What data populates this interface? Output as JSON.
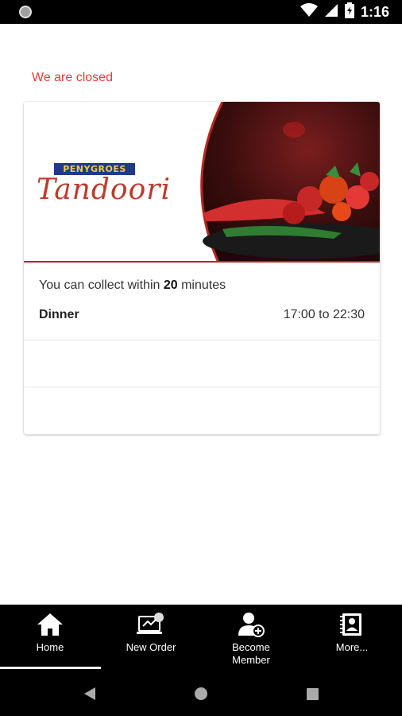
{
  "status_bar": {
    "time": "1:16",
    "icons": [
      "notification-dot-icon",
      "wifi-icon",
      "signal-icon",
      "battery-icon"
    ]
  },
  "notice": {
    "closed_text": "We are closed",
    "color": "#e53935"
  },
  "restaurant": {
    "brand_tag": "PENYGROES",
    "brand_name": "Tandoori",
    "collect_prefix": "You can collect within ",
    "collect_minutes": "20",
    "collect_suffix": " minutes",
    "service_name": "Dinner",
    "service_hours": "17:00 to 22:30"
  },
  "bottom_nav": {
    "items": [
      {
        "label": "Home",
        "icon": "home-icon",
        "selected": true
      },
      {
        "label": "New Order",
        "icon": "new-order-icon",
        "selected": false
      },
      {
        "label": "Become Member",
        "icon": "add-member-icon",
        "selected": false
      },
      {
        "label": "More...",
        "icon": "more-icon",
        "selected": false
      }
    ]
  },
  "system_nav": {
    "icons": [
      "back-icon",
      "home-circle-icon",
      "recents-icon"
    ]
  },
  "colors": {
    "accent": "#e53935",
    "brand_red": "#b5291f",
    "brand_blue": "#1f3a8a"
  }
}
